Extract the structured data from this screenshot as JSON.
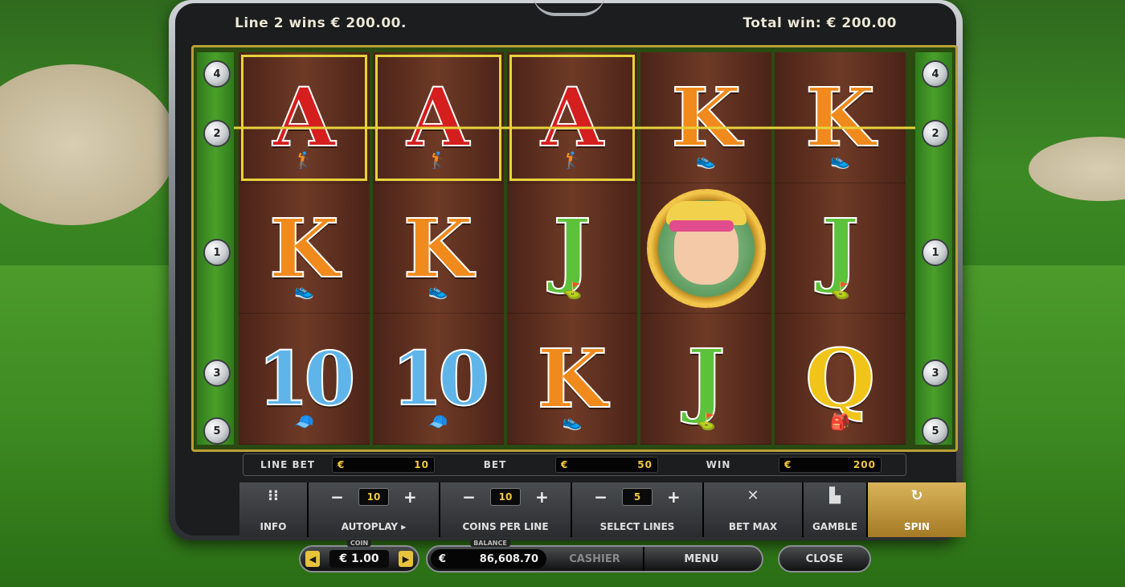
{
  "topbar": {
    "line_win": "Line 2 wins € 200.00.",
    "total_win": "Total win: € 200.00"
  },
  "line_markers": {
    "left": [
      "4",
      "2",
      "1",
      "3",
      "5"
    ],
    "right": [
      "4",
      "2",
      "1",
      "3",
      "5"
    ]
  },
  "reels": [
    [
      {
        "symbol": "A",
        "highlight": true
      },
      {
        "symbol": "K",
        "highlight": false
      },
      {
        "symbol": "10",
        "highlight": false
      }
    ],
    [
      {
        "symbol": "A",
        "highlight": true
      },
      {
        "symbol": "K",
        "highlight": false
      },
      {
        "symbol": "10",
        "highlight": false
      }
    ],
    [
      {
        "symbol": "A",
        "highlight": true
      },
      {
        "symbol": "J",
        "highlight": false
      },
      {
        "symbol": "K",
        "highlight": false
      }
    ],
    [
      {
        "symbol": "K",
        "highlight": false
      },
      {
        "symbol": "WILD",
        "highlight": false
      },
      {
        "symbol": "J",
        "highlight": false
      }
    ],
    [
      {
        "symbol": "K",
        "highlight": false
      },
      {
        "symbol": "J",
        "highlight": false
      },
      {
        "symbol": "Q",
        "highlight": false
      }
    ]
  ],
  "info_bar": {
    "line_bet_label": "LINE BET",
    "line_bet_currency": "€",
    "line_bet_value": "10",
    "bet_label": "BET",
    "bet_currency": "€",
    "bet_value": "50",
    "win_label": "WIN",
    "win_currency": "€",
    "win_value": "200"
  },
  "controls": {
    "info_label": "INFO",
    "autoplay_value": "10",
    "autoplay_label": "AUTOPLAY ▸",
    "coins_value": "10",
    "coins_label": "COINS PER LINE",
    "lines_value": "5",
    "lines_label": "SELECT LINES",
    "betmax_label": "BET MAX",
    "gamble_label": "GAMBLE",
    "spin_label": "SPIN",
    "minus": "−",
    "plus": "+"
  },
  "footer": {
    "coin_tag": "COIN",
    "coin_value": "€ 1.00",
    "balance_tag": "BALANCE",
    "balance_currency": "€",
    "balance_value": "86,608.70",
    "cashier_label": "CASHIER",
    "menu_label": "MENU",
    "close_label": "CLOSE"
  },
  "colors": {
    "highlight": "#e7d23a",
    "payline": "#e7d23a",
    "spin_button": "#c89a3c"
  }
}
